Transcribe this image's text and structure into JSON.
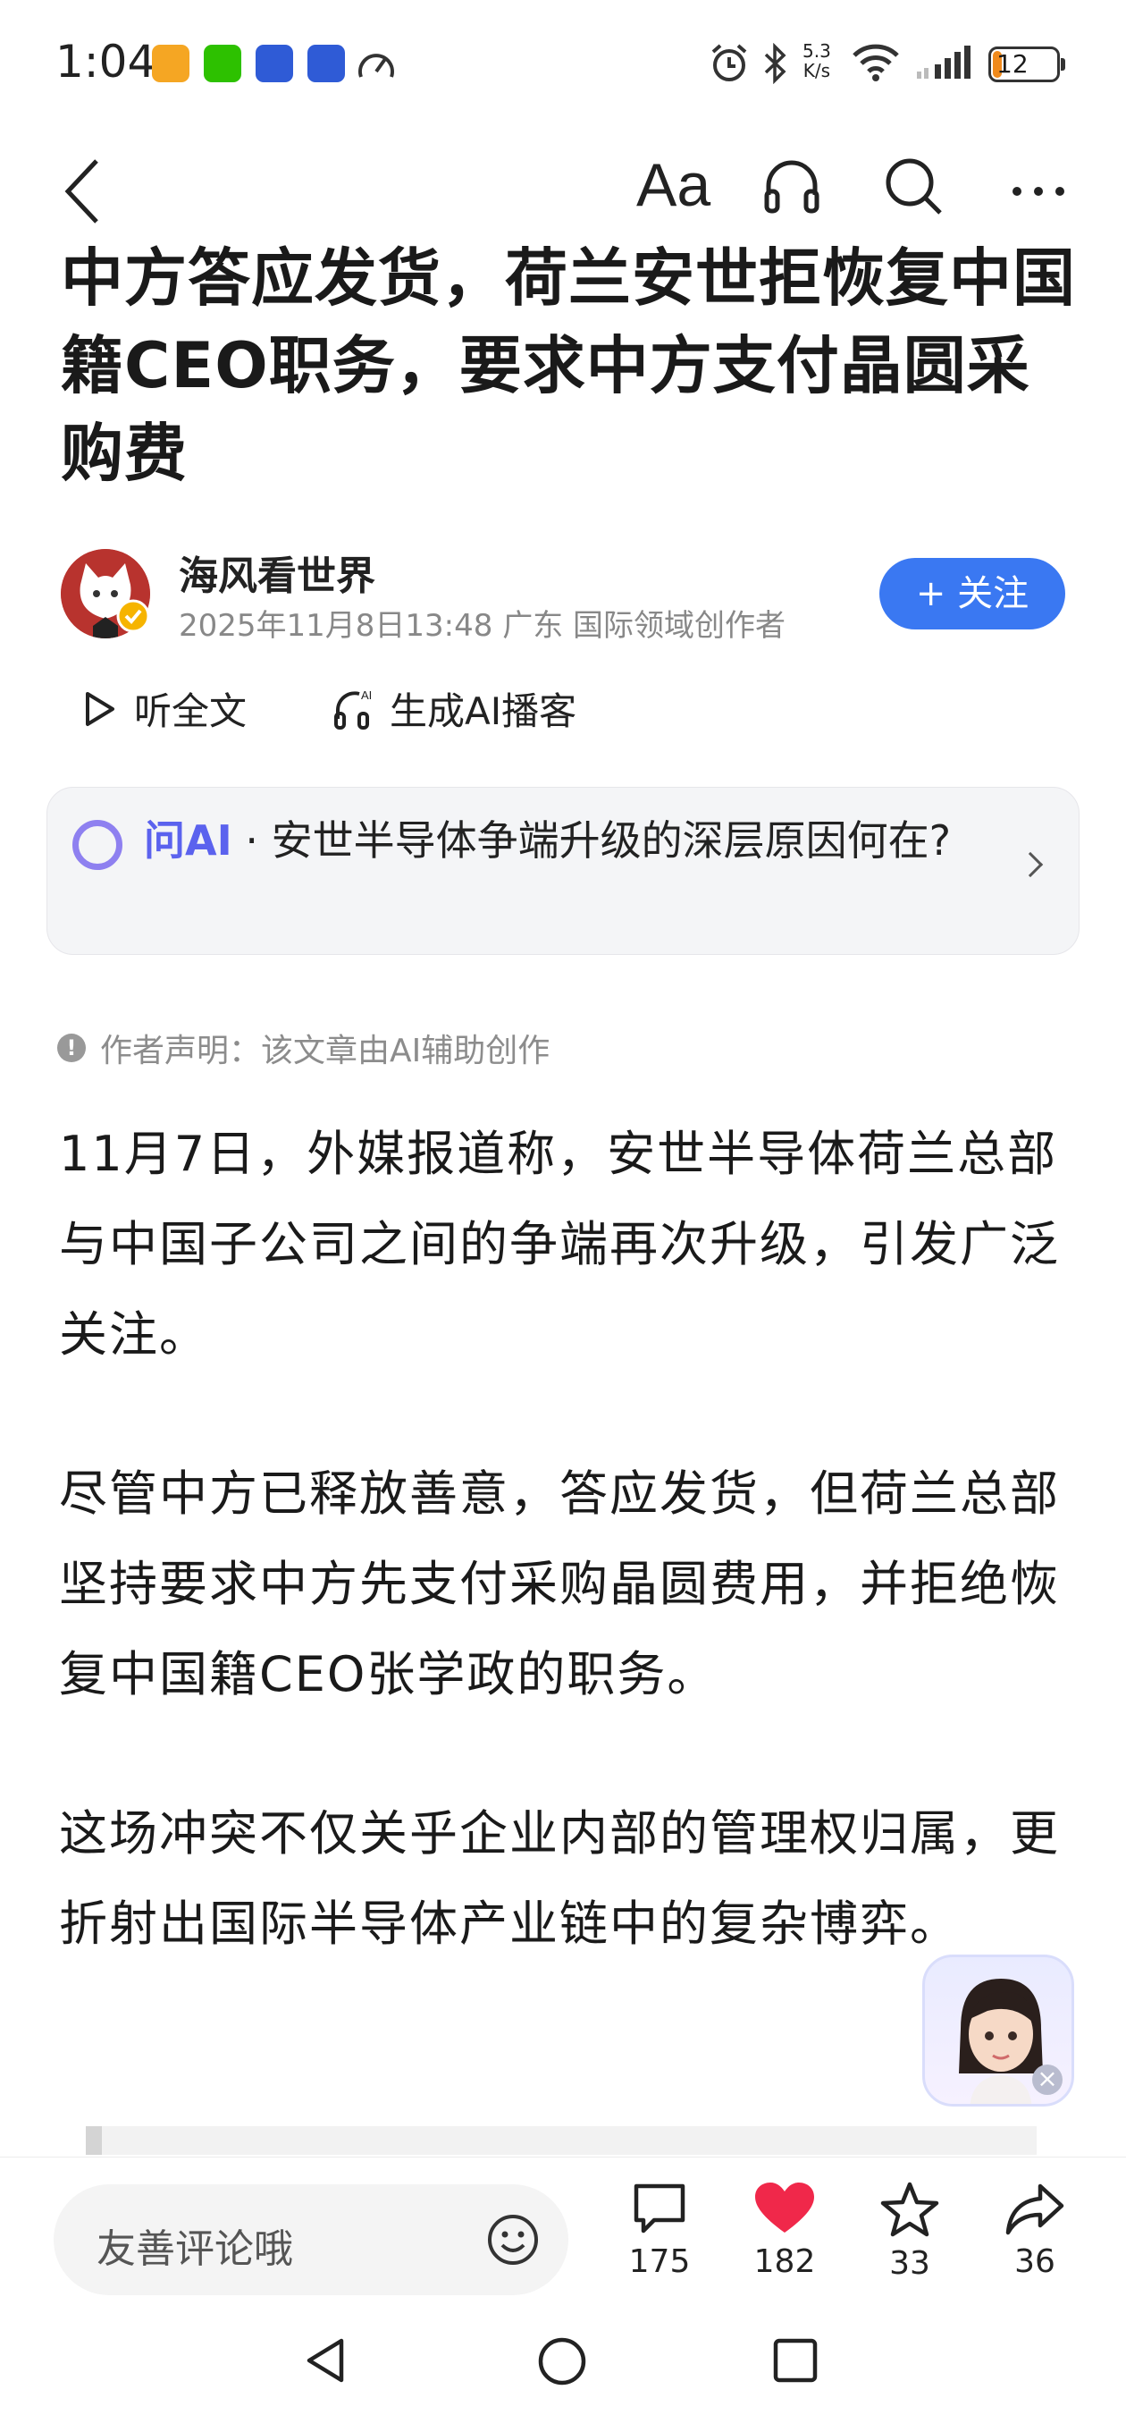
{
  "status_bar": {
    "time": "1:04",
    "net_speed_value": "5.3",
    "net_speed_unit": "K/s",
    "battery": "12",
    "app_icons": [
      "sticky-note-icon",
      "wechat-icon",
      "bot-app-icon",
      "bot-app-icon",
      "speedometer-icon"
    ],
    "status_icons": [
      "alarm-icon",
      "bluetooth-icon",
      "wifi-icon",
      "signal-icon",
      "battery-icon"
    ]
  },
  "top_nav": {
    "font_size_label": "Aa",
    "icons": [
      "back-icon",
      "headphones-icon",
      "search-icon",
      "more-icon"
    ]
  },
  "article": {
    "title": "中方答应发货，荷兰安世拒恢复中国籍CEO职务，要求中方支付晶圆采购费",
    "author": {
      "name": "海风看世界",
      "meta": "2025年11月8日13:48 广东 国际领域创作者",
      "follow_label": "+ 关注"
    },
    "listen_label": "听全文",
    "podcast_label": "生成AI播客",
    "ai_card": {
      "label": "问AI",
      "separator": " · ",
      "question": "安世半导体争端升级的深层原因何在?"
    },
    "statement": "作者声明：该文章由AI辅助创作",
    "paragraphs": [
      "11月7日，外媒报道称，安世半导体荷兰总部与中国子公司之间的争端再次升级，引发广泛关注。",
      "尽管中方已释放善意，答应发货，但荷兰总部坚持要求中方先支付采购晶圆费用，并拒绝恢复中国籍CEO张学政的职务。",
      "这场冲突不仅关乎企业内部的管理权归属，更折射出国际半导体产业链中的复杂博弈。"
    ]
  },
  "bottom_bar": {
    "comment_placeholder": "友善评论哦",
    "comments": "175",
    "likes": "182",
    "favorites": "33",
    "shares": "36"
  },
  "colors": {
    "accent_blue": "#3a78f2",
    "ai_purple": "#5b62ee",
    "like_red": "#f0284a",
    "battery_orange": "#f08a1c"
  }
}
